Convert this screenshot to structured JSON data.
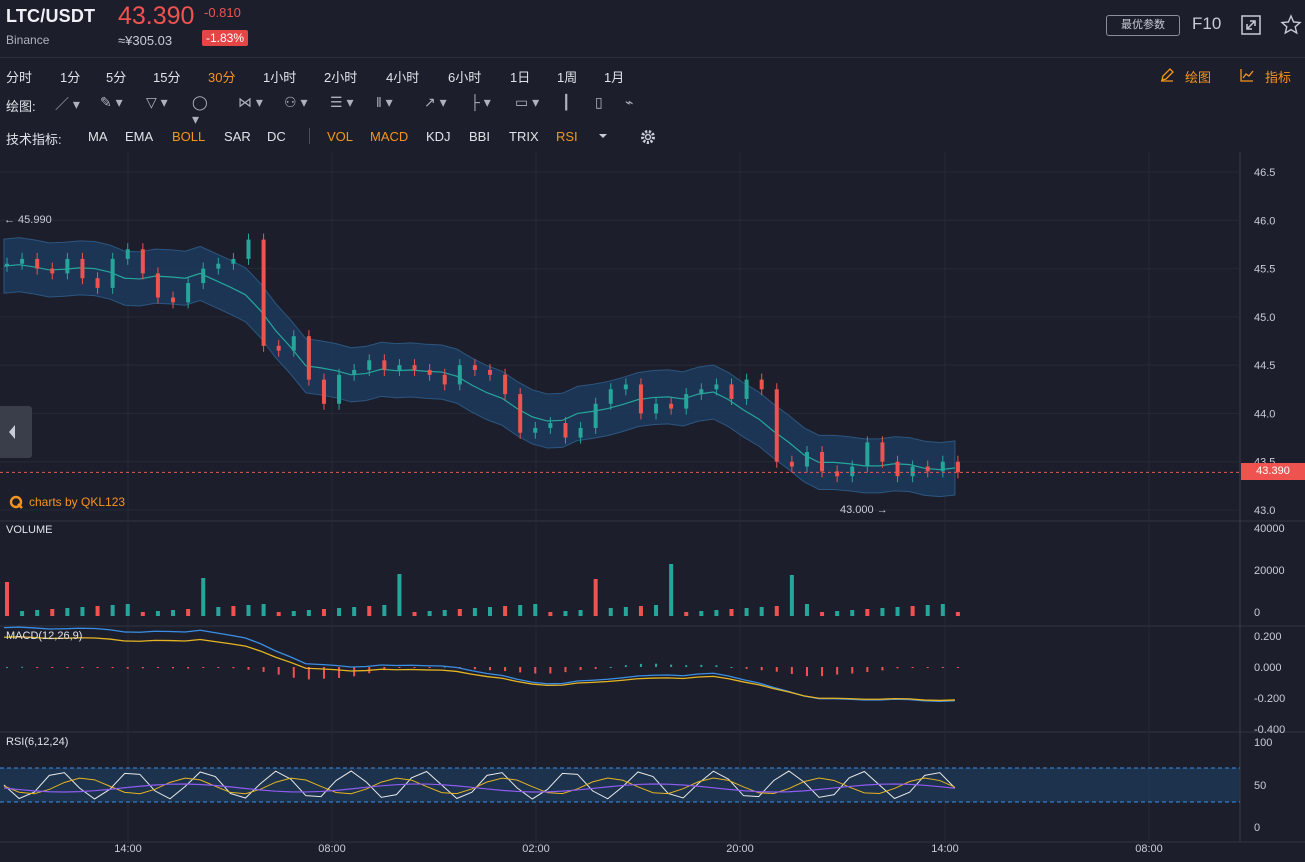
{
  "header": {
    "pair": "LTC/USDT",
    "exchange": "Binance",
    "price": "43.390",
    "change": "-0.810",
    "cny_price": "≈¥305.03",
    "change_pct": "-1.83%",
    "optimal_params_label": "最优参数",
    "f10_label": "F10",
    "icons": [
      "fullscreen-icon",
      "star-icon"
    ]
  },
  "timeframes": [
    {
      "label": "分时",
      "active": false
    },
    {
      "label": "1分",
      "active": false
    },
    {
      "label": "5分",
      "active": false
    },
    {
      "label": "15分",
      "active": false
    },
    {
      "label": "30分",
      "active": true
    },
    {
      "label": "1小时",
      "active": false
    },
    {
      "label": "2小时",
      "active": false
    },
    {
      "label": "4小时",
      "active": false
    },
    {
      "label": "6小时",
      "active": false
    },
    {
      "label": "1日",
      "active": false
    },
    {
      "label": "1周",
      "active": false
    },
    {
      "label": "1月",
      "active": false
    }
  ],
  "right_links": {
    "draw": "绘图",
    "indicators": "指标"
  },
  "drawing": {
    "label": "绘图:",
    "tools": [
      "line-tool-icon",
      "pen-tool-icon",
      "channel-tool-icon",
      "ellipse-tool-icon",
      "zigzag-tool-icon",
      "pattern-tool-icon",
      "fib-tool-icon",
      "gann-tool-icon",
      "arrow-tool-icon",
      "range-tool-icon",
      "comment-tool-icon",
      "bar-tool-icon",
      "trash-icon",
      "eraser-icon"
    ]
  },
  "indicators": {
    "label": "技术指标:",
    "main": [
      {
        "label": "MA",
        "active": false
      },
      {
        "label": "EMA",
        "active": false
      },
      {
        "label": "BOLL",
        "active": true
      },
      {
        "label": "SAR",
        "active": false
      },
      {
        "label": "DC",
        "active": false
      }
    ],
    "sub": [
      {
        "label": "VOL",
        "active": true
      },
      {
        "label": "MACD",
        "active": true
      },
      {
        "label": "KDJ",
        "active": false
      },
      {
        "label": "BBI",
        "active": false
      },
      {
        "label": "TRIX",
        "active": false
      },
      {
        "label": "RSI",
        "active": true
      }
    ]
  },
  "chart": {
    "watermark": "charts by QKL123",
    "high_marker": "← 45.990",
    "low_marker": "43.000 →",
    "last_price_tag": "43.390",
    "price_ticks": [
      "46.5",
      "46.0",
      "45.5",
      "45.0",
      "44.5",
      "44.0",
      "43.5",
      "43.0"
    ],
    "volume_label": "VOLUME",
    "volume_ticks": [
      "40000",
      "20000",
      "0"
    ],
    "macd_label": "MACD(12,26,9)",
    "macd_ticks": [
      "0.200",
      "0.000",
      "-0.200",
      "-0.400"
    ],
    "rsi_label": "RSI(6,12,24)",
    "rsi_ticks": [
      "100",
      "50",
      "0"
    ],
    "time_ticks": [
      "14:00",
      "08:00",
      "02:00",
      "20:00",
      "14:00",
      "08:00"
    ],
    "colors": {
      "up": "#26a69a",
      "down": "#ef5350",
      "band": "#1d3a5c",
      "mid": "#26a69a",
      "background": "#1c1f2b"
    }
  },
  "chart_data": {
    "type": "line",
    "candle_close_path": [
      45.55,
      45.6,
      45.5,
      45.45,
      45.6,
      45.4,
      45.3,
      45.6,
      45.7,
      45.45,
      45.2,
      45.15,
      45.35,
      45.5,
      45.55,
      45.6,
      45.8,
      44.7,
      44.65,
      44.8,
      44.35,
      44.1,
      44.4,
      44.45,
      44.55,
      44.45,
      44.5,
      44.45,
      44.4,
      44.3,
      44.5,
      44.45,
      44.4,
      44.2,
      43.8,
      43.85,
      43.9,
      43.75,
      43.85,
      44.1,
      44.25,
      44.3,
      44.0,
      44.1,
      44.05,
      44.2,
      44.25,
      44.3,
      44.15,
      44.35,
      44.25,
      43.5,
      43.45,
      43.6,
      43.4,
      43.35,
      43.45,
      43.7,
      43.5,
      43.35,
      43.45,
      43.4,
      43.5,
      43.39
    ],
    "price_range": [
      42.9,
      46.6
    ],
    "high": 45.99,
    "low": 43.0,
    "last": 43.39
  }
}
